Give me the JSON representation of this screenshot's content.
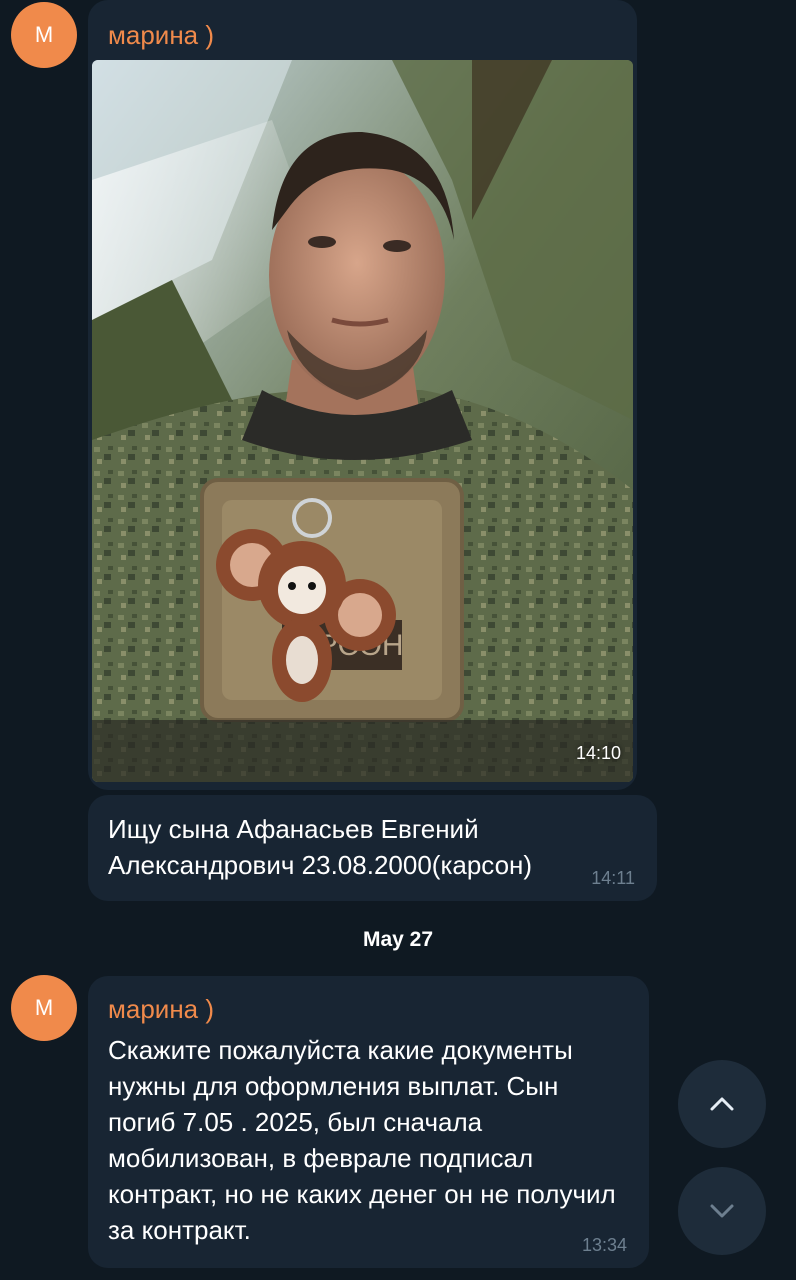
{
  "messages": [
    {
      "avatar_letter": "M",
      "sender": "марина )",
      "photo_time": "14:10"
    },
    {
      "text": "Ищу сына Афанасьев Евгений Александрович 23.08.2000(карсон)",
      "time": "14:11"
    }
  ],
  "date_separator": "May 27",
  "second_message": {
    "avatar_letter": "M",
    "sender": "марина )",
    "text": "Скажите пожалуйста какие документы нужны для оформления выплат. Сын погиб 7.05 . 2025, был сначала мобилизован, в феврале подписал контракт, но не каких денег он не получил за контракт.",
    "time": "13:34"
  },
  "photo": {
    "patch_text": "КАРСОН"
  },
  "controls": {
    "scroll_up_icon": "chevron-up-icon",
    "scroll_down_icon": "chevron-down-icon"
  },
  "colors": {
    "background": "#0f1922",
    "bubble": "#182533",
    "accent": "#f08a4b",
    "timestamp": "#6d7f8f"
  }
}
